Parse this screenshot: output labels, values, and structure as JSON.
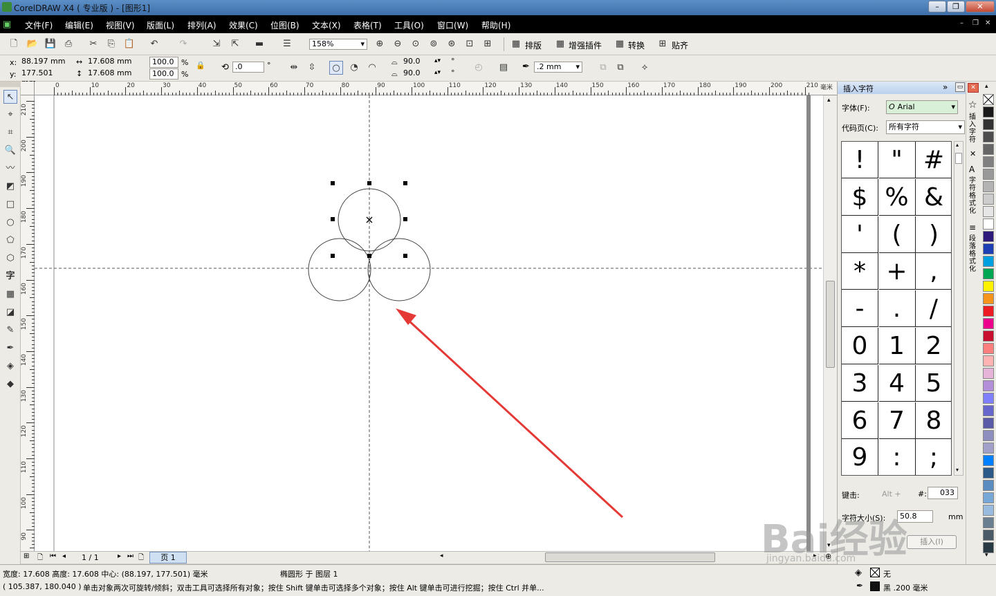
{
  "window": {
    "title": "CorelDRAW X4 ( 专业版 ) - [图形1]"
  },
  "menu": [
    "文件(F)",
    "编辑(E)",
    "视图(V)",
    "版面(L)",
    "排列(A)",
    "效果(C)",
    "位图(B)",
    "文本(X)",
    "表格(T)",
    "工具(O)",
    "窗口(W)",
    "帮助(H)"
  ],
  "toolbar1": {
    "zoom": "158%",
    "items": [
      "排版",
      "增强插件",
      "转换",
      "贴齐"
    ]
  },
  "propbar": {
    "x": "88.197 mm",
    "y": "177.501 mm",
    "w": "17.608 mm",
    "h": "17.608 mm",
    "scale_x": "100.0",
    "scale_y": "100.0",
    "percent": "%",
    "rotate": ".0",
    "degree": "°",
    "angle1": "90.0",
    "angle2": "90.0",
    "outline": ".2 mm",
    "x_label": "x:",
    "y_label": "y:"
  },
  "ruler_h": [
    "0",
    "10",
    "20",
    "30",
    "40",
    "50",
    "60",
    "70",
    "80",
    "90",
    "100",
    "110",
    "120",
    "130",
    "140",
    "150",
    "160",
    "170",
    "180",
    "190",
    "200",
    "210"
  ],
  "ruler_h_unit": "毫米",
  "ruler_v": [
    "210",
    "200",
    "190",
    "180",
    "170",
    "160",
    "150",
    "140",
    "130",
    "120",
    "110",
    "100",
    "90"
  ],
  "page_nav": {
    "counter": "1 / 1",
    "tab": "页 1"
  },
  "docker": {
    "title": "插入字符",
    "font_label": "字体(F):",
    "font_value": "Arial",
    "codepage_label": "代码页(C):",
    "codepage_value": "所有字符",
    "chars": [
      "!",
      "\"",
      "#",
      "$",
      "%",
      "&",
      "'",
      "(",
      ")",
      "*",
      "+",
      ",",
      "-",
      ".",
      "/",
      "0",
      "1",
      "2",
      "3",
      "4",
      "5",
      "6",
      "7",
      "8",
      "9",
      ":",
      ";"
    ],
    "key_label": "键击:",
    "alt_label": "Alt +",
    "hash_label": "#:",
    "code_value": "033",
    "size_label": "字符大小(S):",
    "size_value": "50.8",
    "size_unit": "mm",
    "insert_button": "插入(I)"
  },
  "docker_tabs": [
    "插入字符",
    "字符格式化",
    "段落格式化"
  ],
  "palette_colors": [
    "#1a1a1a",
    "#333333",
    "#4d4d4d",
    "#666666",
    "#808080",
    "#999999",
    "#b3b3b3",
    "#cccccc",
    "#e6e6e6",
    "#ffffff",
    "#2e1a7a",
    "#1e3fb4",
    "#00a0e0",
    "#00a651",
    "#fff200",
    "#f7941d",
    "#ed1c24",
    "#ec008c",
    "#c8102e",
    "#ff7f7f",
    "#ffb3b3",
    "#e6b3d9",
    "#b38fd9",
    "#8080ff",
    "#6666cc",
    "#5a5aa8",
    "#8f8fbf",
    "#a0a0c8",
    "#007fff",
    "#2c5a88",
    "#5a8cbf",
    "#78a8d8",
    "#99bbdd",
    "#6a7f8f",
    "#4a5a66",
    "#2a3a44"
  ],
  "status": {
    "line1_left": "宽度: 17.608  高度: 17.608  中心: (88.197, 177.501)  毫米",
    "line1_mid": "椭圆形 于 图层 1",
    "line2_coords": "( 105.387, 180.040 )",
    "line2_hint": "单击对象两次可旋转/倾斜；双击工具可选择所有对象；按住 Shift 键单击可选择多个对象；按住 Alt 键单击可进行挖掘；按住 Ctrl 并单...",
    "fill_label": "无",
    "outline_label": "黑  .200 毫米"
  },
  "watermark": {
    "main": "Bai经验",
    "sub": "jingyan.baidu.com"
  }
}
